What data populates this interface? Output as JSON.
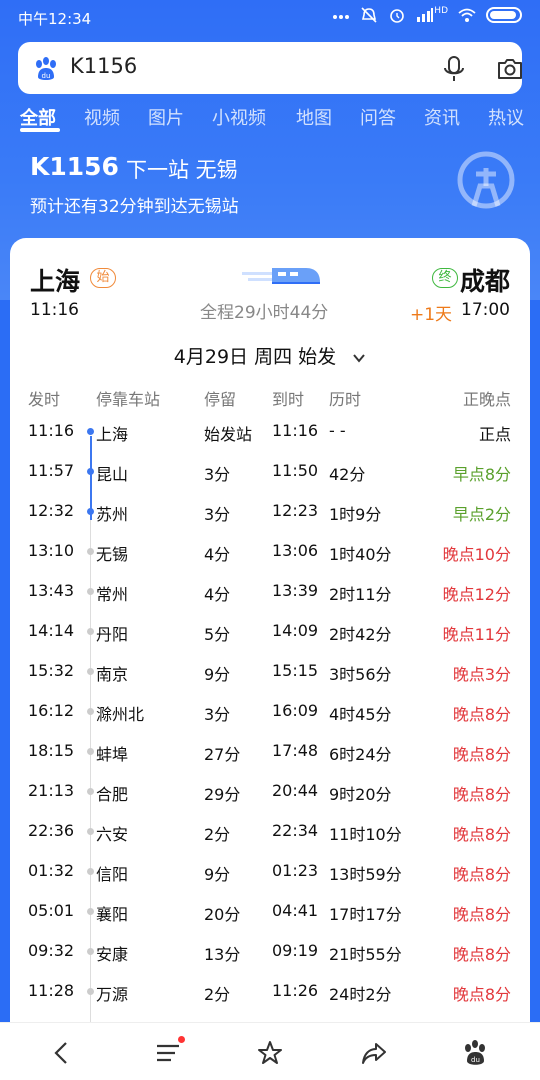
{
  "status_bar": {
    "time": "中午12:34",
    "network": "HD"
  },
  "search": {
    "query": "K1156"
  },
  "tabs": [
    "全部",
    "视频",
    "图片",
    "小视频",
    "地图",
    "问答",
    "资讯",
    "热议"
  ],
  "header": {
    "train_no": "K1156",
    "next_stop": "下一站 无锡",
    "eta": "预计还有32分钟到达无锡站"
  },
  "card": {
    "from_city": "上海",
    "from_badge": "始",
    "to_city": "成都",
    "to_badge": "终",
    "dep_time": "11:16",
    "duration": "全程29小时44分",
    "plus_day": "+1天",
    "arr_time": "17:00",
    "date": "4月29日 周四 始发",
    "headers": {
      "dep": "发时",
      "station": "停靠车站",
      "stop": "停留",
      "arr": "到时",
      "elapsed": "历时",
      "status": "正晚点"
    },
    "rows": [
      {
        "dep": "11:16",
        "station": "上海",
        "stop": "始发站",
        "arr": "11:16",
        "elapsed": "- -",
        "status": "正点",
        "kind": "on",
        "passed": true
      },
      {
        "dep": "11:57",
        "station": "昆山",
        "stop": "3分",
        "arr": "11:50",
        "elapsed": "42分",
        "status": "早点8分",
        "kind": "early",
        "passed": true
      },
      {
        "dep": "12:32",
        "station": "苏州",
        "stop": "3分",
        "arr": "12:23",
        "elapsed": "1时9分",
        "status": "早点2分",
        "kind": "early",
        "passed": true
      },
      {
        "dep": "13:10",
        "station": "无锡",
        "stop": "4分",
        "arr": "13:06",
        "elapsed": "1时40分",
        "status": "晚点10分",
        "kind": "late",
        "passed": false
      },
      {
        "dep": "13:43",
        "station": "常州",
        "stop": "4分",
        "arr": "13:39",
        "elapsed": "2时11分",
        "status": "晚点12分",
        "kind": "late",
        "passed": false
      },
      {
        "dep": "14:14",
        "station": "丹阳",
        "stop": "5分",
        "arr": "14:09",
        "elapsed": "2时42分",
        "status": "晚点11分",
        "kind": "late",
        "passed": false
      },
      {
        "dep": "15:32",
        "station": "南京",
        "stop": "9分",
        "arr": "15:15",
        "elapsed": "3时56分",
        "status": "晚点3分",
        "kind": "late",
        "passed": false
      },
      {
        "dep": "16:12",
        "station": "滁州北",
        "stop": "3分",
        "arr": "16:09",
        "elapsed": "4时45分",
        "status": "晚点8分",
        "kind": "late",
        "passed": false
      },
      {
        "dep": "18:15",
        "station": "蚌埠",
        "stop": "27分",
        "arr": "17:48",
        "elapsed": "6时24分",
        "status": "晚点8分",
        "kind": "late",
        "passed": false
      },
      {
        "dep": "21:13",
        "station": "合肥",
        "stop": "29分",
        "arr": "20:44",
        "elapsed": "9时20分",
        "status": "晚点8分",
        "kind": "late",
        "passed": false
      },
      {
        "dep": "22:36",
        "station": "六安",
        "stop": "2分",
        "arr": "22:34",
        "elapsed": "11时10分",
        "status": "晚点8分",
        "kind": "late",
        "passed": false
      },
      {
        "dep": "01:32",
        "station": "信阳",
        "stop": "9分",
        "arr": "01:23",
        "elapsed": "13时59分",
        "status": "晚点8分",
        "kind": "late",
        "passed": false
      },
      {
        "dep": "05:01",
        "station": "襄阳",
        "stop": "20分",
        "arr": "04:41",
        "elapsed": "17时17分",
        "status": "晚点8分",
        "kind": "late",
        "passed": false
      },
      {
        "dep": "09:32",
        "station": "安康",
        "stop": "13分",
        "arr": "09:19",
        "elapsed": "21时55分",
        "status": "晚点8分",
        "kind": "late",
        "passed": false
      },
      {
        "dep": "11:28",
        "station": "万源",
        "stop": "2分",
        "arr": "11:26",
        "elapsed": "24时2分",
        "status": "晚点8分",
        "kind": "late",
        "passed": false
      }
    ]
  },
  "bottom_nav": [
    "back-icon",
    "menu-icon",
    "star-icon",
    "share-icon",
    "baidu-icon"
  ],
  "colors": {
    "brand_blue": "#2f6ef6",
    "early": "#5aa02c",
    "late": "#e2383c",
    "start_badge": "#f08a3a",
    "end_badge": "#3fb83f"
  }
}
